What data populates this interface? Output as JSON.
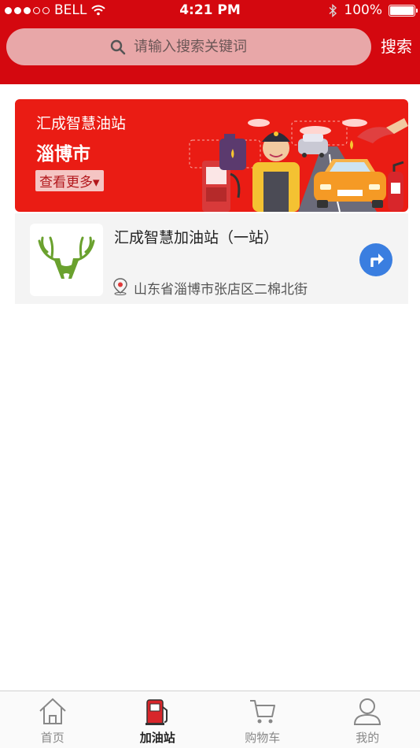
{
  "status_bar": {
    "carrier": "BELL",
    "time": "4:21 PM",
    "battery": "100%",
    "signal_bars": 3,
    "signal_total": 5
  },
  "search": {
    "placeholder": "请输入搜索关键词",
    "button_label": "搜索"
  },
  "banner": {
    "title": "汇成智慧油站",
    "city": "淄博市",
    "more_label": "查看更多▾"
  },
  "station": {
    "name": "汇成智慧加油站（一站）",
    "address": "山东省淄博市张店区二棉北街"
  },
  "tabbar": {
    "active_index": 1,
    "tabs": [
      {
        "label": "首页",
        "icon": "home-icon"
      },
      {
        "label": "加油站",
        "icon": "fuel-pump-icon"
      },
      {
        "label": "购物车",
        "icon": "cart-icon"
      },
      {
        "label": "我的",
        "icon": "user-icon"
      }
    ]
  },
  "colors": {
    "brand_red": "#d4080f",
    "banner_red": "#ea1c14",
    "nav_blue": "#3a7ee0",
    "logo_green": "#6aa12e"
  }
}
